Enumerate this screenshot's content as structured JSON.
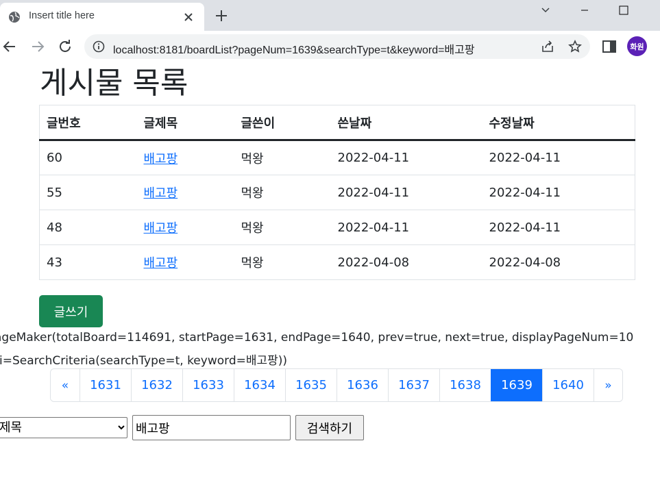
{
  "browser": {
    "tab_title": "Insert title here",
    "url": "localhost:8181/boardList?pageNum=1639&searchType=t&keyword=배고팡",
    "profile_initials": "화원"
  },
  "page": {
    "title": "게시물 목록",
    "table": {
      "headers": [
        "글번호",
        "글제목",
        "글쓴이",
        "쓴날짜",
        "수정날짜"
      ],
      "rows": [
        {
          "no": "60",
          "title": "배고팡",
          "writer": "먹왕",
          "written": "2022-04-11",
          "modified": "2022-04-11"
        },
        {
          "no": "55",
          "title": "배고팡",
          "writer": "먹왕",
          "written": "2022-04-11",
          "modified": "2022-04-11"
        },
        {
          "no": "48",
          "title": "배고팡",
          "writer": "먹왕",
          "written": "2022-04-11",
          "modified": "2022-04-11"
        },
        {
          "no": "43",
          "title": "배고팡",
          "writer": "먹왕",
          "written": "2022-04-08",
          "modified": "2022-04-08"
        }
      ]
    },
    "write_button": "글쓰기",
    "debug_line_1": "ageMaker(totalBoard=114691, startPage=1631, endPage=1640, prev=true, next=true, displayPageNum=10",
    "debug_line_2": "ri=SearchCriteria(searchType=t, keyword=배고팡))",
    "pagination": {
      "prev": "«",
      "pages": [
        "1631",
        "1632",
        "1633",
        "1634",
        "1635",
        "1636",
        "1637",
        "1638",
        "1639",
        "1640"
      ],
      "active": "1639",
      "next": "»"
    },
    "search": {
      "type_selected": "제목",
      "keyword": "배고팡",
      "button": "검색하기"
    }
  },
  "colors": {
    "primary": "#0d6efd",
    "success": "#198754",
    "avatar": "#5b21b6"
  }
}
